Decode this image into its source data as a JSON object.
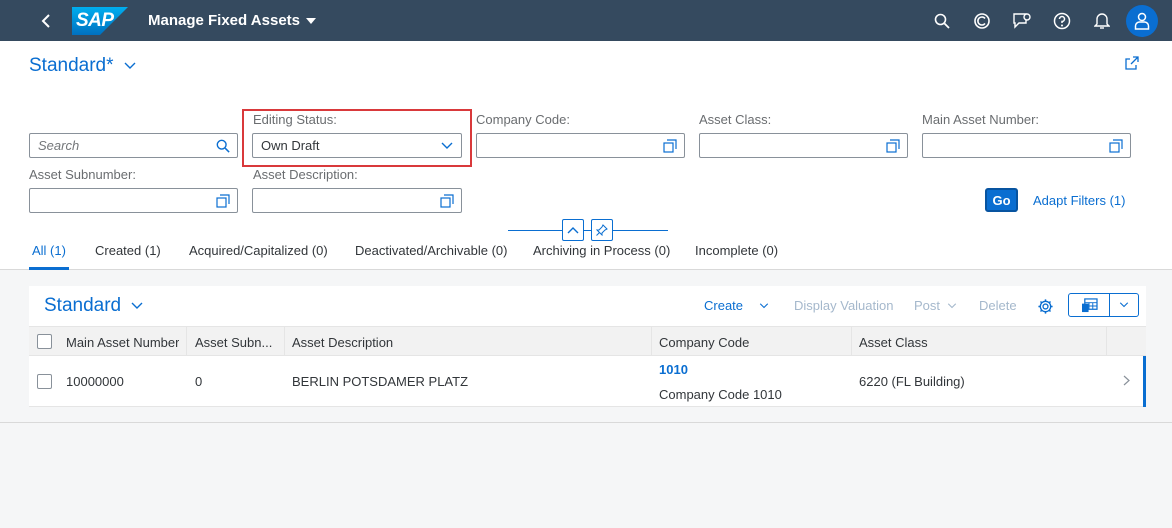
{
  "shell": {
    "app_title": "Manage Fixed Assets",
    "logo_text": "SAP",
    "brand_color": "#354a5f",
    "icons": [
      "search-icon",
      "copilot-icon",
      "notification-chat-icon",
      "help-icon",
      "bell-icon",
      "user-icon"
    ]
  },
  "header": {
    "variant_title": "Standard*"
  },
  "filters": {
    "search_placeholder": "Search",
    "editing_status_label": "Editing Status:",
    "editing_status_value": "Own Draft",
    "company_code_label": "Company Code:",
    "asset_class_label": "Asset Class:",
    "main_asset_number_label": "Main Asset Number:",
    "asset_subnumber_label": "Asset Subnumber:",
    "asset_description_label": "Asset Description:",
    "go_label": "Go",
    "adapt_label": "Adapt Filters (1)"
  },
  "tabs": [
    {
      "label": "All (1)",
      "active": true
    },
    {
      "label": "Created (1)"
    },
    {
      "label": "Acquired/Capitalized (0)"
    },
    {
      "label": "Deactivated/Archivable (0)"
    },
    {
      "label": "Archiving in Process (0)"
    },
    {
      "label": "Incomplete (0)"
    }
  ],
  "table": {
    "title": "Standard",
    "toolbar": {
      "create": "Create",
      "display_valuation": "Display Valuation",
      "post": "Post",
      "delete": "Delete"
    },
    "columns": [
      "Main Asset Number",
      "Asset Subn...",
      "Asset Description",
      "Company Code",
      "Asset Class"
    ],
    "rows": [
      {
        "main_asset_number": "10000000",
        "asset_subnumber": "0",
        "asset_description": "BERLIN POTSDAMER PLATZ",
        "company_code": "1010",
        "company_code_name": "Company Code 1010",
        "asset_class": "6220 (FL Building)"
      }
    ]
  }
}
